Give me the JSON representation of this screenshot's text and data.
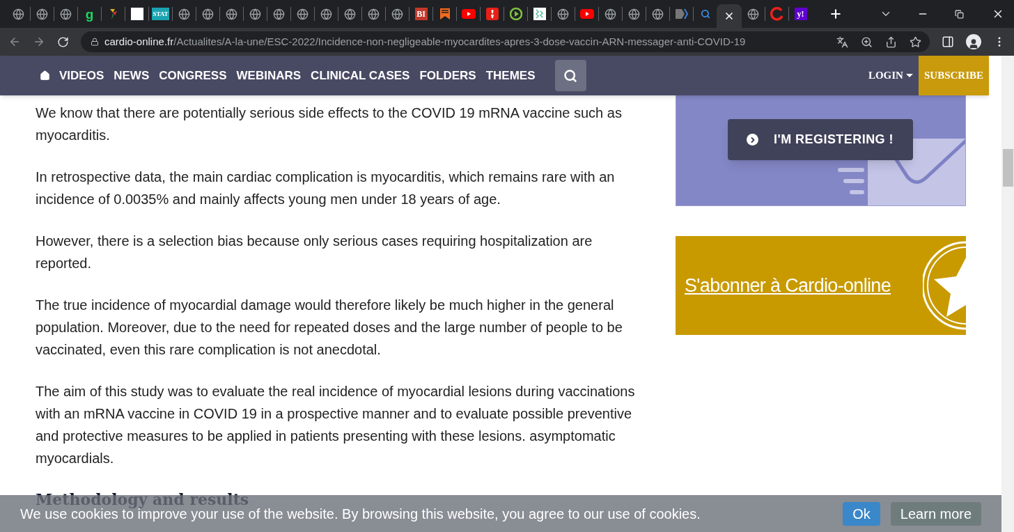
{
  "browser": {
    "tabs": [
      {
        "kind": "globe",
        "selected": false
      },
      {
        "kind": "globe",
        "selected": false
      },
      {
        "kind": "globe",
        "selected": false
      },
      {
        "kind": "letter",
        "glyph": "g",
        "color": "#1ed760",
        "selected": false
      },
      {
        "kind": "pinwheel",
        "selected": false
      },
      {
        "kind": "square",
        "selected": false
      },
      {
        "kind": "tile",
        "glyph": "STAT",
        "color": "#1aa3b0",
        "selected": false
      },
      {
        "kind": "globe",
        "selected": false
      },
      {
        "kind": "globe",
        "selected": false
      },
      {
        "kind": "globe",
        "selected": false
      },
      {
        "kind": "globe",
        "selected": false
      },
      {
        "kind": "globe",
        "selected": false
      },
      {
        "kind": "globe",
        "selected": false
      },
      {
        "kind": "globe",
        "selected": false
      },
      {
        "kind": "globe",
        "selected": false
      },
      {
        "kind": "globe",
        "selected": false
      },
      {
        "kind": "globe",
        "selected": false
      },
      {
        "kind": "tile",
        "glyph": "BI",
        "color": "#c0392b",
        "selected": false
      },
      {
        "kind": "bookmark",
        "selected": false
      },
      {
        "kind": "youtube",
        "selected": false
      },
      {
        "kind": "podcast",
        "selected": false
      },
      {
        "kind": "play",
        "selected": false
      },
      {
        "kind": "pattern",
        "selected": false
      },
      {
        "kind": "globe",
        "selected": false
      },
      {
        "kind": "youtube",
        "selected": false
      },
      {
        "kind": "globe",
        "selected": false
      },
      {
        "kind": "globe",
        "selected": false
      },
      {
        "kind": "globe",
        "selected": false
      },
      {
        "kind": "chevron",
        "selected": false
      },
      {
        "kind": "search",
        "selected": false
      },
      {
        "kind": "close",
        "selected": true
      },
      {
        "kind": "globe",
        "selected": false
      },
      {
        "kind": "ring",
        "selected": false
      },
      {
        "kind": "tile",
        "glyph": "y!",
        "color": "#6001d2",
        "selected": false
      }
    ],
    "address": {
      "domain": "cardio-online.fr",
      "path": "/Actualites/A-la-une/ESC-2022/Incidence-non-negligeable-myocardites-apres-3-dose-vaccin-ARN-messager-anti-COVID-19"
    }
  },
  "nav": {
    "items": [
      "VIDEOS",
      "NEWS",
      "CONGRESS",
      "WEBINARS",
      "CLINICAL CASES",
      "FOLDERS",
      "THEMES"
    ],
    "login": "LOGIN",
    "subscribe": "SUBSCRIBE"
  },
  "article": {
    "paragraphs": [
      "We know that there are potentially serious side effects to the COVID 19 mRNA vaccine such as myocarditis.",
      "In retrospective data, the main cardiac complication is myocarditis, which remains rare with an incidence of 0.0035% and mainly affects young men under 18 years of age.",
      "However, there is a selection bias because only serious cases requiring hospitalization are reported.",
      "The true incidence of myocardial damage would therefore likely be much higher in the general population. Moreover, due to the need for repeated doses and the large number of people to be vaccinated, even this rare complication is not anecdotal.",
      "The aim of this study was to evaluate the real incidence of myocardial lesions during vaccinations with an mRNA vaccine in COVID 19 in a prospective manner and to evaluate possible preventive and protective measures to be applied in patients presenting with these lesions. asymptomatic myocardials."
    ],
    "heading": "Methodology and results"
  },
  "sidebar": {
    "register_button": "I'M REGISTERING !",
    "subscribe_link": "S'abonner à Cardio-online"
  },
  "cookie_bar": {
    "message": "We use cookies to improve your use of the website. By browsing this website, you agree to our use of cookies.",
    "ok": "Ok",
    "learn_more": "Learn more"
  }
}
